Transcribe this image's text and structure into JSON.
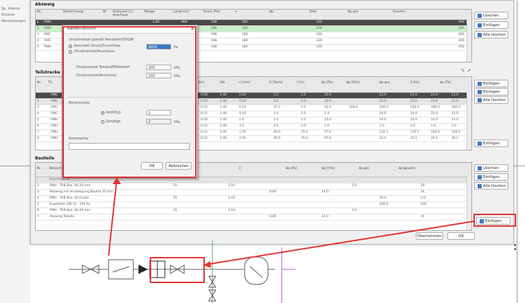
{
  "background": {
    "sidebar_rows": [
      "Sp. Interior",
      "Exterior",
      "Abmessungen"
    ]
  },
  "main_window": {
    "top_group_title": "Abzweig",
    "top_columns": [
      "Nr.",
      "Bezeichnung",
      "Bl",
      "Schlüssel [1] Anschluss",
      "Menge",
      "Länge [m]",
      "Druck [Pa]",
      "v",
      "Δp",
      "Zeta",
      "Δp ges",
      "Durchm."
    ],
    "top_rows": [
      {
        "c1": "PWH",
        "c2": "",
        "c3": "",
        "c4": "",
        "c5": "1.80",
        "c6": "800",
        "c7": "588",
        "c8": "180",
        "c9": "",
        "c10": "330",
        "c11": "",
        "c12": "400",
        "style": "dk"
      },
      {
        "c1": "PWH",
        "c2": "",
        "c3": "",
        "c4": "",
        "c5": "1.80",
        "c6": "800",
        "c7": "588",
        "c8": "180",
        "c9": "",
        "c10": "330",
        "c11": "",
        "c12": "400",
        "style": "g"
      },
      {
        "c1": "PWC",
        "c2": "",
        "c3": "",
        "c4": "",
        "c5": "1.80",
        "c6": "800",
        "c7": "508",
        "c8": "180",
        "c9": "",
        "c10": "330",
        "c11": "",
        "c12": "400",
        "style": ""
      },
      {
        "c1": "PWC",
        "c2": "",
        "c3": "",
        "c4": "",
        "c5": "1.80",
        "c6": "800",
        "c7": "508",
        "c8": "180",
        "c9": "",
        "c10": "330",
        "c11": "",
        "c12": "400",
        "style": ""
      },
      {
        "c1": "PWH",
        "c2": "",
        "c3": "",
        "c4": "",
        "c5": "1.80",
        "c6": "800",
        "c7": "508",
        "c8": "180",
        "c9": "",
        "c10": "330",
        "c11": "",
        "c12": "400",
        "style": ""
      }
    ],
    "mid_group_title": "Teilstrecke",
    "mid_columns": [
      "Nr.",
      "TS",
      "Bezeichnung",
      "V̇ [l/s]",
      "DN",
      "v [m/s]",
      "R [Pa/m]",
      "l [m]",
      "Δp [Pa]",
      "Δp [hPa]",
      "Δp ges",
      "V̇ [l/s]",
      "Δp [Pa]"
    ],
    "mid_rows": [
      {
        "c1": "PWC",
        "c2": "0.50",
        "c3": "1.40",
        "c4": "0.10",
        "c5": "2.5",
        "c6": "1.0",
        "c7": "21.0",
        "c8": "",
        "c9": "21.0",
        "c10": "21.0",
        "c11": "21.0",
        "c12": "21.0",
        "style": "dk"
      },
      {
        "c1": "PWC",
        "c2": "0.50",
        "c3": "1.40",
        "c4": "0.10",
        "c5": "2.5",
        "c6": "1.0",
        "c7": "12.0",
        "c8": "",
        "c9": "21.0",
        "c10": "21.0",
        "c11": "21.0",
        "c12": "21.0",
        "style": "gr"
      },
      {
        "c1": "PWC",
        "c2": "0.52",
        "c3": "1.40",
        "c4": "0.10",
        "c5": "37.2",
        "c6": "1.0",
        "c7": "12.0",
        "c8": "200.0",
        "c9": "200.0",
        "c10": "214.0",
        "c11": "280.0",
        "c12": "280.0",
        "style": ""
      },
      {
        "c1": "PWC",
        "c2": "0.52",
        "c3": "1.40",
        "c4": "0.10",
        "c5": "1.0",
        "c6": "1.0",
        "c7": "2.4",
        "c8": "",
        "c9": "24.0",
        "c10": "24.0",
        "c11": "22.0",
        "c12": "22.0",
        "style": ""
      },
      {
        "c1": "PWH",
        "c2": "0.50",
        "c3": "1.40",
        "c4": "1.0",
        "c5": "1.0",
        "c6": "1.0",
        "c7": "21.0",
        "c8": "",
        "c9": "14.0",
        "c10": "14.0",
        "c11": "14.0",
        "c12": "14.0",
        "style": ""
      },
      {
        "c1": "PWH",
        "c2": "0.50",
        "c3": "1.40",
        "c4": "1.0",
        "c5": "1.0",
        "c6": "1.0",
        "c7": "1.0",
        "c8": "",
        "c9": "1.0",
        "c10": "1.0",
        "c11": "1.0",
        "c12": "1.0",
        "style": ""
      },
      {
        "c1": "PWH",
        "c2": "0.52",
        "c3": "2.00",
        "c4": "1.50",
        "c5": "26.0",
        "c6": "25.0",
        "c7": "57.0",
        "c8": "",
        "c9": "132.5",
        "c10": "132.5",
        "c11": "184.0",
        "c12": "184.0",
        "style": ""
      },
      {
        "c1": "PWH",
        "c2": "0.52",
        "c3": "2.00",
        "c4": "1.50",
        "c5": "26.0",
        "c6": "25.0",
        "c7": "57.0",
        "c8": "",
        "c9": "22.1",
        "c10": "22.1",
        "c11": "26.1",
        "c12": "26.1",
        "style": ""
      }
    ],
    "bottom_group_title": "Bauteile",
    "bottom_columns": [
      "Nr.",
      "Bezeichnung",
      "Menge",
      "ζ",
      "Δp [Pa]",
      "Δp [hPa]",
      "Δp ges",
      "Δp gesamt"
    ],
    "bottom_rows": [
      {
        "name": "Anschluss TS",
        "qty": "",
        "z": "",
        "dp": "",
        "dph": "",
        "dpg": "",
        "dpt": "",
        "style": "gr"
      },
      {
        "name": "PWH - TAB Bez. 40-20 mm",
        "qty": "25",
        "z": "1.10",
        "dp": "",
        "dph": "5.0",
        "dpg": "",
        "dpt": "20",
        "style": ""
      },
      {
        "name": "Abzweig mit Verzweigung Bauteil 20 mm",
        "qty": "",
        "z": "",
        "dp": "0.80",
        "dph": "14.0",
        "dpg": "",
        "dpt": "14",
        "style": ""
      },
      {
        "name": "PWH - TAB Bez. 40 Grade",
        "qty": "25",
        "z": "0.10",
        "dp": "",
        "dph": "",
        "dpg": "20.0",
        "dpt": "2.0",
        "style": ""
      },
      {
        "name": "Kugelhahn DN 15 - 100 Pa",
        "qty": "",
        "z": "",
        "dp": "",
        "dph": "",
        "dpg": "200.0",
        "dpt": "200",
        "style": ""
      },
      {
        "name": "PWH - TAB Bez. 40-20 mm",
        "qty": "25",
        "z": "1.10",
        "dp": "",
        "dph": "5.0",
        "dpg": "",
        "dpt": "",
        "style": ""
      },
      {
        "name": "Abzweig Tabelle",
        "qty": "",
        "z": "",
        "dp": "0.80",
        "dph": "14.0",
        "dpg": "",
        "dpt": "14",
        "style": ""
      }
    ],
    "side_buttons": {
      "top_1": "Löschen",
      "top_2": "Einfügen",
      "top_3": "Alle löschen",
      "mid_1": "Einfügen",
      "mid_2": "Einfügen",
      "mid_3": "Alle löschen",
      "mid_4": "Einfügen",
      "bot_1": "Löschen",
      "bot_2": "Einfügen",
      "bot_3": "Alle löschen",
      "bot_4": "Einfügen"
    },
    "footer_buttons": {
      "apply": "Übernehmen",
      "ok": "OK"
    }
  },
  "dialog": {
    "title": "Bauteil-Ansicht",
    "section1_label": "Druckverlust gemäß Hersteller/DVGW",
    "radio1": "Kennzahl Druck/Durchfluss",
    "radio2": "Druckverlust/Anschluss",
    "field1_value": "6800",
    "field1_unit": "Pa",
    "label_a": "Druckverlust Bauteil/Mittelwert",
    "field_a_value": "200",
    "field_a_unit": "hPa",
    "label_b": "Druckverlust/Anschluss",
    "field_b_value": "200",
    "field_b_unit": "hPa",
    "section2_label": "Berechnung",
    "radio3": "Ventiltyp",
    "radio3_value": "2",
    "radio4": "Sonstige",
    "radio4_value": "2",
    "radio4_unit": "hPa",
    "comment_label": "Kommentar",
    "ok_label": "OK",
    "cancel_label": "Abbrechen"
  },
  "colors": {
    "highlight_red": "#e23232",
    "row_green": "#c8efc8",
    "selection_blue": "#3a77c7"
  }
}
